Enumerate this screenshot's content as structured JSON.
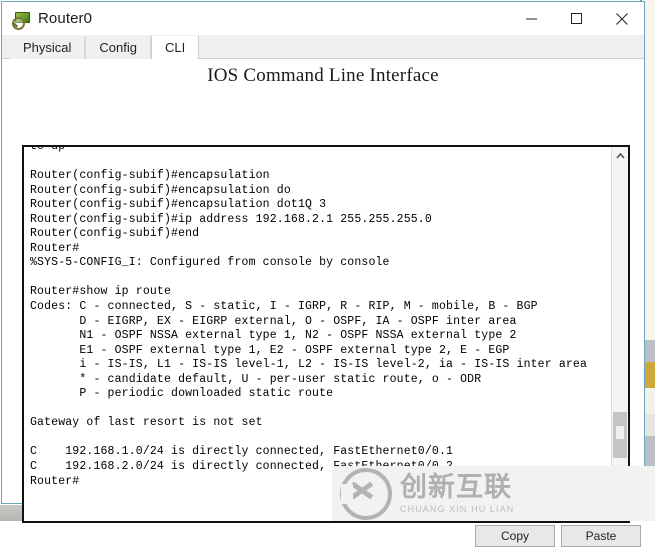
{
  "window": {
    "title": "Router0",
    "icon": "router-magnifier-icon",
    "controls": {
      "minimize": "minimize-icon",
      "maximize": "maximize-icon",
      "close": "close-icon"
    }
  },
  "tabs": [
    {
      "id": "physical",
      "label": "Physical",
      "active": false
    },
    {
      "id": "config",
      "label": "Config",
      "active": false
    },
    {
      "id": "cli",
      "label": "CLI",
      "active": true
    }
  ],
  "panel": {
    "heading": "IOS Command Line Interface"
  },
  "terminal": {
    "lines": [
      "to up",
      "",
      "Router(config-subif)#encapsulation",
      "Router(config-subif)#encapsulation do",
      "Router(config-subif)#encapsulation dot1Q 3",
      "Router(config-subif)#ip address 192.168.2.1 255.255.255.0",
      "Router(config-subif)#end",
      "Router#",
      "%SYS-5-CONFIG_I: Configured from console by console",
      "",
      "Router#show ip route",
      "Codes: C - connected, S - static, I - IGRP, R - RIP, M - mobile, B - BGP",
      "       D - EIGRP, EX - EIGRP external, O - OSPF, IA - OSPF inter area",
      "       N1 - OSPF NSSA external type 1, N2 - OSPF NSSA external type 2",
      "       E1 - OSPF external type 1, E2 - OSPF external type 2, E - EGP",
      "       i - IS-IS, L1 - IS-IS level-1, L2 - IS-IS level-2, ia - IS-IS inter area",
      "       * - candidate default, U - per-user static route, o - ODR",
      "       P - periodic downloaded static route",
      "",
      "Gateway of last resort is not set",
      "",
      "C    192.168.1.0/24 is directly connected, FastEthernet0/0.1",
      "C    192.168.2.0/24 is directly connected, FastEthernet0/0.2",
      "Router#"
    ]
  },
  "scrollbar": {
    "up_icon": "chevron-up-icon",
    "down_icon": "chevron-down-icon"
  },
  "buttons": {
    "copy": "Copy",
    "paste": "Paste"
  },
  "watermark": {
    "cn": "创新互联",
    "en": "CHUANG XIN HU LIAN",
    "logo": "cx-circle-logo"
  }
}
